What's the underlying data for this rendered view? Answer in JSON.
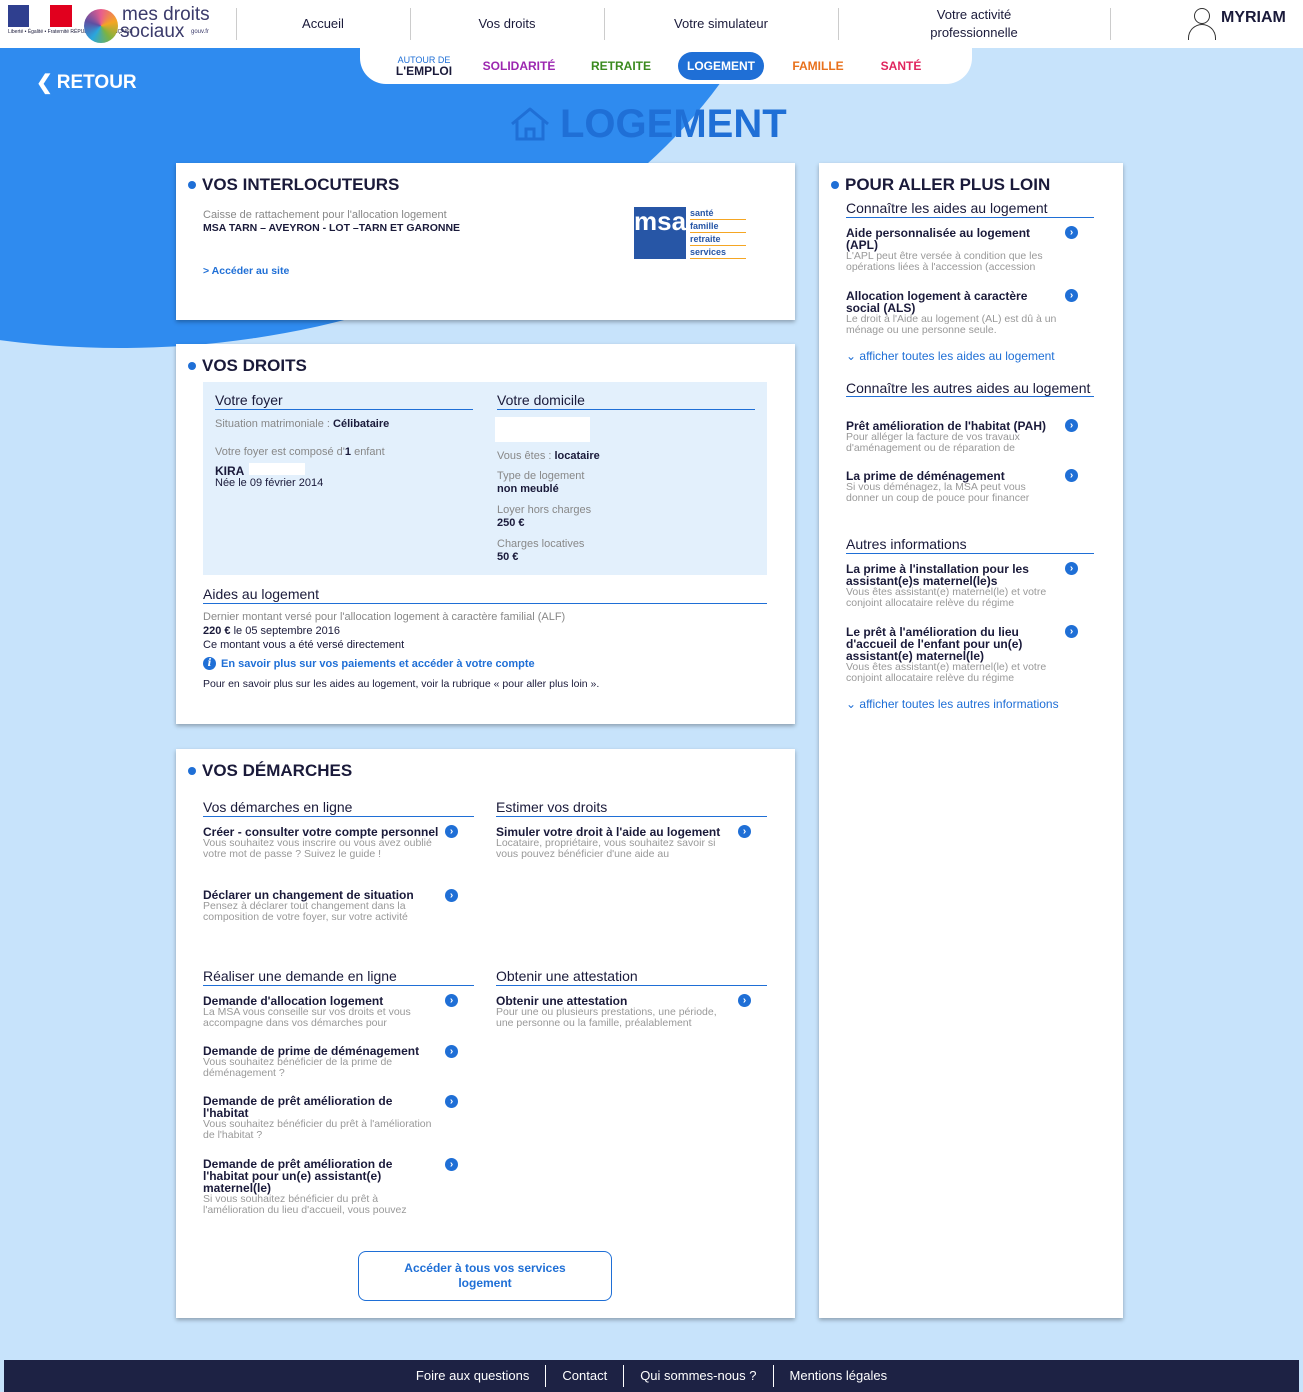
{
  "header": {
    "rf_text": "Liberté • Égalité • Fraternité RÉPUBLIQUE FRANÇAISE",
    "brand_line1": "mes droits",
    "brand_line2": "sociaux",
    "brand_suffix": "gouv.fr",
    "nav": [
      "Accueil",
      "Vos droits",
      "Votre simulateur",
      "Votre activité professionnelle"
    ],
    "user_name": "MYRIAM"
  },
  "tabs": {
    "emploi_small": "AUTOUR DE",
    "emploi": "L'EMPLOI",
    "solidarite": "SOLIDARITÉ",
    "retraite": "RETRAITE",
    "logement": "LOGEMENT",
    "famille": "FAMILLE",
    "sante": "SANTÉ",
    "colors": {
      "solidarite": "#9c27b0",
      "retraite": "#3a8a1e",
      "famille": "#e8711c",
      "sante": "#e0245e",
      "active": "#1f6fd6"
    }
  },
  "retour": "RETOUR",
  "page_title": "LOGEMENT",
  "interlocuteurs": {
    "title": "VOS INTERLOCUTEURS",
    "caption": "Caisse de rattachement pour l'allocation logement",
    "caisse": "MSA TARN – AVEYRON - LOT –TARN ET GARONNE",
    "link": "> Accéder au site",
    "msa_logo": {
      "letters": "msa",
      "lines": [
        "santé",
        "famille",
        "retraite",
        "services"
      ]
    }
  },
  "droits": {
    "title": "VOS DROITS",
    "foyer_h": "Votre foyer",
    "situation_label": "Situation matrimoniale :",
    "situation_value": "Célibataire",
    "compose_prefix": "Votre foyer est composé d'",
    "compose_count": "1",
    "compose_suffix": " enfant",
    "child_name": "KIRA",
    "child_birth": "Née le 09 février 2014",
    "domicile_h": "Votre domicile",
    "vous_etes_label": "Vous êtes :",
    "vous_etes_value": "locataire",
    "type_label": "Type de logement",
    "type_value": "non meublé",
    "loyer_label": "Loyer hors charges",
    "loyer_value": "250 €",
    "charges_label": "Charges locatives",
    "charges_value": "50 €",
    "aides_h": "Aides au logement",
    "aides_caption": "Dernier montant versé pour l'allocation logement à caractère familial (ALF)",
    "montant": "220 €",
    "montant_date": " le 05 septembre 2016",
    "verse": "Ce montant vous a été versé directement",
    "info_link": "En savoir plus sur vos paiements et accéder à votre compte",
    "more_text": "Pour en savoir plus sur les aides au logement, voir la rubrique « pour aller plus loin »."
  },
  "demarches": {
    "title": "VOS DÉMARCHES",
    "en_ligne_h": "Vos démarches en ligne",
    "estimer_h": "Estimer vos droits",
    "realiser_h": "Réaliser une demande en ligne",
    "attestation_h": "Obtenir une attestation",
    "en_ligne": [
      {
        "title": "Créer - consulter votre compte personnel",
        "desc": "Vous souhaitez vous inscrire ou vous avez oublié votre mot de passe ? Suivez le guide !"
      },
      {
        "title": "Déclarer un changement de situation",
        "desc": "Pensez à déclarer tout changement dans la composition de votre foyer, sur votre activité"
      }
    ],
    "estimer": [
      {
        "title": "Simuler votre droit à l'aide au logement",
        "desc": "Locataire, propriétaire, vous souhaitez savoir si vous pouvez bénéficier d'une aide au"
      }
    ],
    "realiser": [
      {
        "title": "Demande d'allocation logement",
        "desc": "La MSA vous conseille sur vos droits et vous accompagne dans vos démarches pour"
      },
      {
        "title": "Demande de prime de déménagement",
        "desc": "Vous souhaitez bénéficier de la prime de déménagement ?"
      },
      {
        "title": "Demande de prêt amélioration de l'habitat",
        "desc": "Vous souhaitez bénéficier du prêt à l'amélioration de l'habitat ?"
      },
      {
        "title": "Demande de prêt amélioration de l'habitat pour un(e) assistant(e) maternel(le)",
        "desc": "Si vous souhaitez bénéficier du prêt à l'amélioration du lieu d'accueil, vous pouvez"
      }
    ],
    "attestation": [
      {
        "title": "Obtenir une attestation",
        "desc": "Pour une ou plusieurs prestations, une période, une personne ou la famille, préalablement"
      }
    ],
    "services_button": "Accéder à tous vos services logement"
  },
  "plus_loin": {
    "title": "POUR ALLER PLUS LOIN",
    "aides_h": "Connaître les aides au logement",
    "aides": [
      {
        "title": "Aide personnalisée au logement (APL)",
        "desc": "L'APL peut être versée à condition que les opérations liées à l'accession (accession"
      },
      {
        "title": "Allocation logement à caractère social (ALS)",
        "desc": "Le droit à l'Aide au logement (AL) est dû à un ménage ou une personne seule."
      }
    ],
    "aides_more": "afficher toutes les aides au logement",
    "autres_aides_h": "Connaître les autres aides au logement",
    "autres_aides": [
      {
        "title": "Prêt amélioration de l'habitat (PAH)",
        "desc": "Pour alléger la facture de vos travaux d'aménagement ou de réparation de"
      },
      {
        "title": "La prime de déménagement",
        "desc": "Si vous déménagez, la MSA peut vous donner un coup de pouce pour financer"
      }
    ],
    "infos_h": "Autres informations",
    "infos": [
      {
        "title": "La prime à l'installation pour les assistant(e)s maternel(le)s",
        "desc": "Vous êtes assistant(e) maternel(le) et votre conjoint allocataire relève du régime"
      },
      {
        "title": "Le prêt à l'amélioration du lieu d'accueil de l'enfant pour un(e) assistant(e) maternel(le)",
        "desc": "Vous êtes assistant(e) maternel(le) et votre conjoint allocataire relève du régime"
      }
    ],
    "infos_more": "afficher toutes les autres informations"
  },
  "footer": [
    "Foire aux questions",
    "Contact",
    "Qui sommes-nous ?",
    "Mentions légales"
  ],
  "icons": {
    "go": "chevron-right-circle-icon",
    "info": "info-icon",
    "expand": "chevron-down-icon",
    "back": "chevron-left-icon",
    "house": "house-icon",
    "user": "user-icon"
  }
}
